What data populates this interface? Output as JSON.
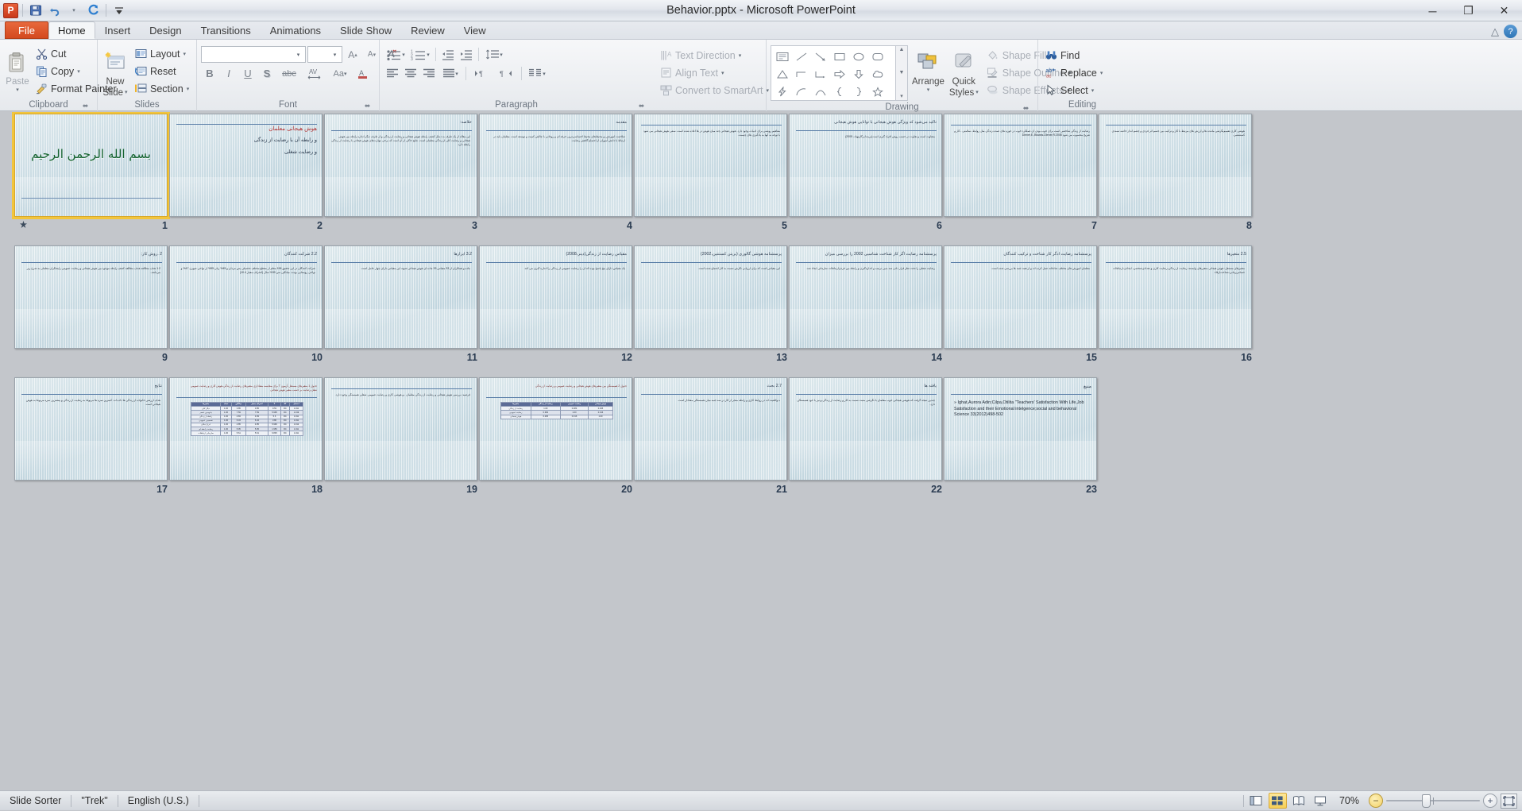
{
  "window": {
    "title": "Behavior.pptx  -  Microsoft PowerPoint",
    "app_logo": "powerpoint-logo",
    "minimize": "─",
    "restore": "❐",
    "close": "✕"
  },
  "quick_access": {
    "save": "save-icon",
    "undo": "undo-icon",
    "undo_caret": "▾",
    "redo": "redo-icon",
    "customize": "▾"
  },
  "tabs": [
    {
      "label": "File",
      "kind": "file"
    },
    {
      "label": "Home",
      "kind": "active"
    },
    {
      "label": "Insert",
      "kind": "normal"
    },
    {
      "label": "Design",
      "kind": "normal"
    },
    {
      "label": "Transitions",
      "kind": "normal"
    },
    {
      "label": "Animations",
      "kind": "normal"
    },
    {
      "label": "Slide Show",
      "kind": "normal"
    },
    {
      "label": "Review",
      "kind": "normal"
    },
    {
      "label": "View",
      "kind": "normal"
    }
  ],
  "tab_right": {
    "minimize_ribbon": "△",
    "help": "?"
  },
  "ribbon": {
    "clipboard": {
      "title": "Clipboard",
      "paste": "Paste",
      "cut": "Cut",
      "copy": "Copy",
      "format_painter": "Format Painter",
      "dialog_launcher": "⬌"
    },
    "slides": {
      "title": "Slides",
      "new_slide_line1": "New",
      "new_slide_line2": "Slide",
      "layout": "Layout",
      "reset": "Reset",
      "section": "Section"
    },
    "font": {
      "title": "Font",
      "font_name": "",
      "font_size": "",
      "grow": "A▴",
      "shrink": "A▾",
      "clear_formatting": "clear-formatting-icon",
      "bold": "B",
      "italic": "I",
      "underline": "U",
      "shadow": "S",
      "strikethrough": "abc",
      "character_spacing": "AV",
      "change_case": "Aa",
      "font_color": "A",
      "dialog_launcher": "⬌"
    },
    "paragraph": {
      "title": "Paragraph",
      "bullets": "bullets-icon",
      "numbering": "numbering-icon",
      "decrease_indent": "decrease-indent-icon",
      "increase_indent": "increase-indent-icon",
      "line_spacing": "line-spacing-icon",
      "align_left": "align-left-icon",
      "align_center": "align-center-icon",
      "align_right": "align-right-icon",
      "justify": "justify-icon",
      "ltr": "left-to-right-icon",
      "rtl": "right-to-left-icon",
      "columns": "columns-icon",
      "text_direction": "Text Direction",
      "align_text": "Align Text",
      "convert_to_smartart": "Convert to SmartArt",
      "dialog_launcher": "⬌"
    },
    "drawing": {
      "title": "Drawing",
      "arrange": "Arrange",
      "quick_styles_line1": "Quick",
      "quick_styles_line2": "Styles",
      "shape_fill": "Shape Fill",
      "shape_outline": "Shape Outline",
      "shape_effects": "Shape Effects",
      "dialog_launcher": "⬌",
      "shapes": [
        "▤",
        "╲",
        "↘",
        "▭",
        "◯",
        "▢",
        "△",
        "⌐",
        "⌙",
        "⇨",
        "⇩",
        "☁",
        "⚡",
        "⌒",
        "⌢",
        "{",
        "}",
        "☆"
      ]
    },
    "editing": {
      "title": "Editing",
      "find": "Find",
      "replace": "Replace",
      "select": "Select"
    }
  },
  "status_bar": {
    "view_name": "Slide Sorter",
    "theme": "\"Trek\"",
    "language": "English (U.S.)",
    "zoom_level": "70%",
    "views": [
      {
        "name": "normal-view-button",
        "glyph": "▥",
        "active": false
      },
      {
        "name": "slide-sorter-view-button",
        "glyph": "▦",
        "active": true
      },
      {
        "name": "reading-view-button",
        "glyph": "◫",
        "active": false
      },
      {
        "name": "slide-show-button",
        "glyph": "▷",
        "active": false
      }
    ],
    "zoom_out": "−",
    "zoom_in": "+",
    "fit_to_window": "fit-slide-to-window-icon"
  },
  "slides": [
    {
      "number": "1",
      "type": "bismillah",
      "has_animation": true,
      "bism": "بسم الله الرحمن الرحيم",
      "title": "",
      "body": ""
    },
    {
      "number": "2",
      "type": "title",
      "title": "هوش هیجانی معلمان",
      "line2": "و رابطه آن با رضایت از زندگی",
      "line3": "و رضایت شغلی"
    },
    {
      "number": "3",
      "type": "text",
      "title": "خلاصه:",
      "body": "این مقاله از یک طرف به دنبال کشف رابطه هوش هیجانی و رضایت از زندگی و از طرف دیگر اندازه رابطه بین هوش هیجانی و رضایت کلی از زندگی معلمان است. نتایج حاکی از آن است که برخی مهارت‌های هوش هیجانی با رضایت از زندگی رابطه دارد."
    },
    {
      "number": "4",
      "type": "text",
      "title": "مقدمه",
      "body": "صلاحیت آموزشی و محیط‌های محیط احساسی‌ترین حرفه ای و روحانی با چالش کمیت و توسعه است. معلمان باید در ارتباط با دانش آموزان از اجتماع گاهش رضایت."
    },
    {
      "number": "5",
      "type": "text",
      "title": "",
      "body": "مفاهیم روشنی برای ادبیات وجود دارد. هوش هیجانی چند میان هوش در ها اعاده شده است. سعی هوش هیجانی می شود با توجه به آنها به یادگیری های چیست."
    },
    {
      "number": "6",
      "type": "text",
      "title": "تاکید می‌شود که ویژگی هوش هیجانی با توانایی هوش هیجانی",
      "body": "متفاوت است و تفاوت در حسب روش افراد گیری است(بریت‌ابرگارتهیاد، 2005)"
    },
    {
      "number": "7",
      "type": "text",
      "title": "",
      "body": "رضایت از زندگی شاخصی است برای خوب بودن آن عملکرد خوب در حوزه های عمده زندگی مثل روابط، سلامتی ، کار و تفریح محسوب می شود Diener,E.,Biswas-Diener,R.2008"
    },
    {
      "number": "8",
      "type": "text",
      "title": "",
      "body": "هوشی کاری تعمیم‌نگرشی ماننده ها و ارزش های مرتبط با کار و ترکیب بین جسم اثر فردی و چشم انداز خاصه تسندی کستنتشی."
    },
    {
      "number": "9",
      "type": "text",
      "title": "2 .روش کار:",
      "body": "1.2 هدف مطالعه هدف مطالعه کشف رابطه موجود بین هوش هیجانی و رضایت عمومی زایشگران معلمان به شرح زیر می‌باشد."
    },
    {
      "number": "10",
      "type": "text",
      "title": "2.2 شرکت کنندگان",
      "body": "شرکت کنندگان در این تحقیق 196 معلم از مقطع مختلف تحصیلی پس مردان و 45% زنان 55% از نواحی شهری 47% و نواحی روستایی بودند. میانگین سن 39% سال (انحراف معیار 10.4)"
    },
    {
      "number": "11",
      "type": "text",
      "title": "3.2 ابزارها",
      "body": "ماده و همکاران از 33 مقیاس 33 ماده ای هوش هیجانی شوته این مقیاس دارای چهار عامل است."
    },
    {
      "number": "12",
      "type": "text",
      "title": "مقیاس رضایت از زندگی(دینر،2008)",
      "body": "یک مقیاس دارای پنج پاسخ بوده که آن را رضایت عمومی از زندگی را اندازه گیری می کند."
    },
    {
      "number": "13",
      "type": "text",
      "title": "پرسشنامه هوشی گالوری (بریتن کستنتین،2002)",
      "body": "این مقیاس است که برای ارزیابی نگرش نسبت به کار اجتماع شده است."
    },
    {
      "number": "14",
      "type": "text",
      "title": "پرسشنامه رضایت اگر کار شناخت شناسیی 2002 را بررسی میزان",
      "body": "رضایت شغلی را تحت نظر قرار دادن سه بدین ترتیب و اندازه‌گیری و رابطه بین فردی‌ارتباطات سازمانی ایجاد شد."
    },
    {
      "number": "15",
      "type": "text",
      "title": "پرسشنامه رضایت ادگر کار شناخت و ترکیب کنندگان",
      "body": "معلمان آموزش های مختلف صادقانه عمل کرده اند و از همه جنبه ها بررسی شده است."
    },
    {
      "number": "16",
      "type": "text",
      "title": "2.5 متغیرها",
      "body": "متغیرهای مستقل: هوش هیجانی متغیرهای وابسته: رضایت از زندگی،رضایت کاری و تعدادی‌شخصی، ایجادی،ارتباطات حساس‌زمانی،شناخت‌ارقاء"
    },
    {
      "number": "17",
      "type": "text",
      "title": "نتایج",
      "body": "هدف ارزشی خانواده از زندگی ها داده اند. کمترین نمره ها مربوط به رضایت از زندگی و بیشترین نمره مربوط به هوش هیجانی است."
    },
    {
      "number": "18",
      "type": "table",
      "title": "جدول 1 متغیرهای مستقل آزمون T برای مقایسه معناداری متغیرهای رضایت از زندگی،هوش کاری و رضایت عمومی شغل،رضایت بر حسب متغیر هوش هیجانی",
      "table": {
        "headers": [
          "متغیرها",
          "تعداد",
          "میانگین",
          "انحراف معیار",
          "T",
          "df",
          "احتمال"
        ],
        "rows": [
          [
            "دیگر کلی",
            "1.00",
            "3.85",
            "3.85",
            "9.53",
            "RC",
            "1.011"
          ],
          [
            "پادوه‌بین عنصر",
            "1.00",
            "7.59",
            "7.59",
            "5.995",
            "RC",
            "1.019"
          ],
          [
            "رابطه از زندگی",
            "1.00",
            "4.83",
            "4.83",
            "5.6",
            "RC",
            "1.011"
          ],
          [
            "تقسیمی عمومی",
            "1.00",
            "6.34",
            "6.34",
            "3.86",
            "RC",
            "1.011"
          ],
          [
            "ابزار امکان",
            "1.00",
            "4.85",
            "4.85",
            "5.996",
            "RC",
            "1.012"
          ],
          [
            "رضایت رابطه ای",
            "1.00",
            "5.05",
            "5.05",
            "1.956",
            "RC",
            "1.011"
          ],
          [
            "سازمانی ارتباطات",
            "1.00",
            "5.61",
            "5.61",
            "6.845",
            "RC",
            "1.011"
          ]
        ]
      }
    },
    {
      "number": "19",
      "type": "text",
      "title": "",
      "body": "فرضیه: بررسی هوش هیجانی و رضایت از زندگی معلمان ، و هوشی کاری و رضایت عمومی شغلی همبستگی وجود دارد."
    },
    {
      "number": "20",
      "type": "table",
      "title": "جدول 2 همبستگی بین متغیرهای هوش هیجانی و رضایت عمومی و رضایت از زندگی",
      "table": {
        "headers": [
          "متغیرها",
          "رضایت از زندگی",
          "رضایت عمومی",
          "هوش هیجانی"
        ],
        "rows": [
          [
            "رضایت از زندگی",
            "1.00",
            "0.384",
            "0.295"
          ],
          [
            "رضایت عمومی",
            "0.384",
            "1.00",
            "0.316"
          ],
          [
            "هوش هیجانی",
            "0.295",
            "0.316",
            "1.00"
          ]
        ]
      }
    },
    {
      "number": "21",
      "type": "text",
      "title": "2.7 بحث",
      "body": "ه واقعیت اند در روابط کاری و رابطه منجر از کار در سه جنبه میان همبستگی معنادار است."
    },
    {
      "number": "22",
      "type": "text",
      "title": "یافته ها",
      "body": "چندین نتیجه گرفت که هوشی هیجانی خوب معلمان با نگرشی مثبت نسبت به کار و رضایت از زندگی و نیز با خود همبستگی دارد."
    },
    {
      "number": "23",
      "type": "reference",
      "title": "منبع",
      "bullet": "»",
      "body": "Ighat,Aurora Adin;Cilpa,Otilita \"Teachers' Satisfaction With Life,Job Satisfaction and their Emotional intelgence;social and behavioral Science  33(2012)498-502"
    }
  ]
}
